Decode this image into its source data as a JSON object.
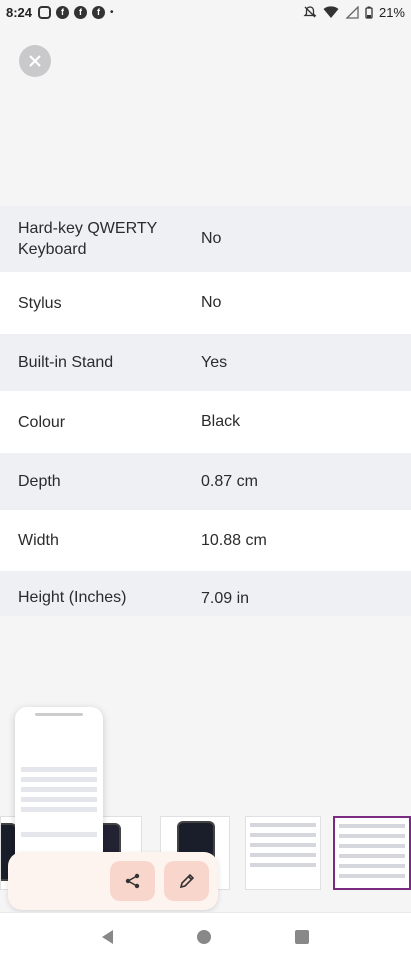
{
  "status_bar": {
    "time": "8:24",
    "battery": "21%",
    "notification_icons": [
      "instagram-icon",
      "facebook-icon",
      "facebook-icon",
      "facebook-icon",
      "dot-icon"
    ],
    "system_icons": [
      "mute-icon",
      "wifi-icon",
      "signal-icon",
      "battery-icon"
    ]
  },
  "specs": [
    {
      "label": "Hard-key QWERTY Keyboard",
      "value": "No"
    },
    {
      "label": "Stylus",
      "value": "No"
    },
    {
      "label": "Built-in Stand",
      "value": "Yes"
    },
    {
      "label": "Colour",
      "value": "Black"
    },
    {
      "label": "Depth",
      "value": "0.87 cm"
    },
    {
      "label": "Width",
      "value": "10.88 cm"
    },
    {
      "label": "Height (Inches)",
      "value": "7.09 in"
    }
  ],
  "colors": {
    "row_alt": "#eef0f4",
    "row_white": "#ffffff",
    "accent": "#7b2a83",
    "action_button": "#f9d6cb"
  },
  "actions": {
    "share_icon": "share-icon",
    "edit_icon": "edit-icon"
  }
}
